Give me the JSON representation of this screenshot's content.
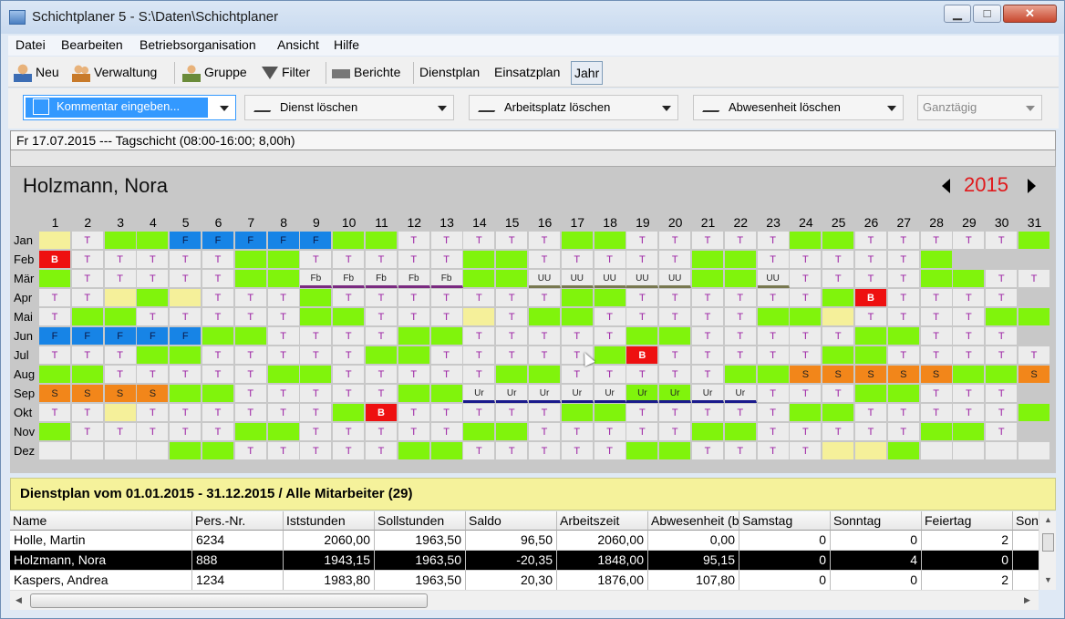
{
  "window": {
    "title": "Schichtplaner 5 - S:\\Daten\\Schichtplaner"
  },
  "menu": [
    "Datei",
    "Bearbeiten",
    "Betriebsorganisation",
    "Ansicht",
    "Hilfe"
  ],
  "toolbar": {
    "neu": "Neu",
    "verwaltung": "Verwaltung",
    "gruppe": "Gruppe",
    "filter": "Filter",
    "berichte": "Berichte",
    "dienstplan": "Dienstplan",
    "einsatzplan": "Einsatzplan",
    "jahr": "Jahr"
  },
  "dropdowns": {
    "kommentar": "Kommentar eingeben...",
    "dienst": "Dienst löschen",
    "arbeitsplatz": "Arbeitsplatz löschen",
    "abwesenheit": "Abwesenheit löschen",
    "ganztaegig": "Ganztägig"
  },
  "info": "Fr 17.07.2015 --- Tagschicht (08:00-16:00; 8,00h)",
  "calendar": {
    "employee": "Holzmann, Nora",
    "year": "2015",
    "days": [
      "1",
      "2",
      "3",
      "4",
      "5",
      "6",
      "7",
      "8",
      "9",
      "10",
      "11",
      "12",
      "13",
      "14",
      "15",
      "16",
      "17",
      "18",
      "19",
      "20",
      "21",
      "22",
      "23",
      "24",
      "25",
      "26",
      "27",
      "28",
      "29",
      "30",
      "31"
    ],
    "months": [
      {
        "label": "Jan",
        "cells": [
          "y",
          "T",
          "g",
          "g",
          "F:b",
          "F:b",
          "F:b",
          "F:b",
          "F:b",
          "g",
          "g",
          "T",
          "T",
          "T",
          "T",
          "T",
          "g",
          "g",
          "T",
          "T",
          "T",
          "T",
          "T",
          "g",
          "g",
          "T",
          "T",
          "T",
          "T",
          "T",
          "g"
        ]
      },
      {
        "label": "Feb",
        "cells": [
          "B:r",
          "T",
          "T",
          "T",
          "T",
          "T",
          "g",
          "g",
          "T",
          "T",
          "T",
          "T",
          "T",
          "g",
          "g",
          "T",
          "T",
          "T",
          "T",
          "T",
          "g",
          "g",
          "T",
          "T",
          "T",
          "T",
          "T",
          "g",
          "x",
          "x",
          "x"
        ]
      },
      {
        "label": "Mär",
        "cells": [
          "g",
          "T",
          "T",
          "T",
          "T",
          "T",
          "g",
          "g",
          "Fb:p",
          "Fb:p",
          "Fb:p",
          "Fb:p",
          "Fb:p",
          "g",
          "g",
          "UU:k",
          "UU:k",
          "UU:k",
          "UU:k",
          "UU:k",
          "g",
          "g",
          "UU:k",
          "T",
          "T",
          "T",
          "T",
          "g",
          "g",
          "T",
          "T"
        ]
      },
      {
        "label": "Apr",
        "cells": [
          "T",
          "T",
          "y",
          "g",
          "y",
          "T",
          "T",
          "T",
          "g",
          "T",
          "T",
          "T",
          "T",
          "T",
          "T",
          "T",
          "g",
          "g",
          "T",
          "T",
          "T",
          "T",
          "T",
          "T",
          "g",
          "B:r",
          "T",
          "T",
          "T",
          "T",
          "x"
        ]
      },
      {
        "label": "Mai",
        "cells": [
          "T",
          "g",
          "g",
          "T",
          "T",
          "T",
          "T",
          "T",
          "g",
          "g",
          "T",
          "T",
          "T",
          "y",
          "T",
          "g",
          "g",
          "T",
          "T",
          "T",
          "T",
          "T",
          "g",
          "g",
          "y",
          "T",
          "T",
          "T",
          "T",
          "g",
          "g"
        ]
      },
      {
        "label": "Jun",
        "cells": [
          "F:b",
          "F:b",
          "F:b",
          "F:b",
          "F:b",
          "g",
          "g",
          "T",
          "T",
          "T",
          "T",
          "g",
          "g",
          "T",
          "T",
          "T",
          "T",
          "T",
          "g",
          "g",
          "T",
          "T",
          "T",
          "T",
          "T",
          "g",
          "g",
          "T",
          "T",
          "T",
          "x"
        ]
      },
      {
        "label": "Jul",
        "cells": [
          "T",
          "T",
          "T",
          "g",
          "g",
          "T",
          "T",
          "T",
          "T",
          "T",
          "g",
          "g",
          "T",
          "T",
          "T",
          "T",
          "T",
          "g",
          "B:r",
          "T",
          "T",
          "T",
          "T",
          "T",
          "g",
          "g",
          "T",
          "T",
          "T",
          "T",
          "T"
        ]
      },
      {
        "label": "Aug",
        "cells": [
          "g",
          "g",
          "T",
          "T",
          "T",
          "T",
          "T",
          "g",
          "g",
          "T",
          "T",
          "T",
          "T",
          "T",
          "g",
          "g",
          "T",
          "T",
          "T",
          "T",
          "T",
          "g",
          "g",
          "S:o",
          "S:o",
          "S:o",
          "S:o",
          "S:o",
          "g",
          "g",
          "S:o"
        ]
      },
      {
        "label": "Sep",
        "cells": [
          "S:o",
          "S:o",
          "S:o",
          "S:o",
          "g",
          "g",
          "T",
          "T",
          "T",
          "T",
          "T",
          "g",
          "g",
          "Ur:n",
          "Ur:n",
          "Ur:n",
          "Ur:n",
          "Ur:n",
          "Ur:nG",
          "Ur:nG",
          "Ur:n",
          "Ur:n",
          "T",
          "T",
          "T",
          "g",
          "g",
          "T",
          "T",
          "T",
          "x"
        ]
      },
      {
        "label": "Okt",
        "cells": [
          "T",
          "T",
          "y",
          "T",
          "T",
          "T",
          "T",
          "T",
          "T",
          "g",
          "B:r",
          "T",
          "T",
          "T",
          "T",
          "T",
          "g",
          "g",
          "T",
          "T",
          "T",
          "T",
          "T",
          "g",
          "g",
          "T",
          "T",
          "T",
          "T",
          "T",
          "g"
        ]
      },
      {
        "label": "Nov",
        "cells": [
          "g",
          "T",
          "T",
          "T",
          "T",
          "T",
          "g",
          "g",
          "T",
          "T",
          "T",
          "T",
          "T",
          "g",
          "g",
          "T",
          "T",
          "T",
          "T",
          "T",
          "g",
          "g",
          "T",
          "T",
          "T",
          "T",
          "T",
          "g",
          "g",
          "T",
          "x"
        ]
      },
      {
        "label": "Dez",
        "cells": [
          "f",
          "f",
          "f",
          "f",
          "g",
          "g",
          "T",
          "T",
          "T",
          "T",
          "T",
          "g",
          "g",
          "T",
          "T",
          "T",
          "T",
          "T",
          "g",
          "g",
          "T",
          "T",
          "T",
          "T",
          "y",
          "y",
          "g",
          "f",
          "f",
          "f",
          "f"
        ]
      }
    ]
  },
  "summary": "Dienstplan vom 01.01.2015 - 31.12.2015 / Alle Mitarbeiter (29)",
  "table": {
    "columns": [
      "Name",
      "Pers.-Nr.",
      "Iststunden",
      "Sollstunden",
      "Saldo",
      "Arbeitszeit",
      "Abwesenheit (b",
      "Samstag",
      "Sonntag",
      "Feiertag",
      "Son"
    ],
    "rows": [
      [
        "Holle, Martin",
        "6234",
        "2060,00",
        "1963,50",
        "96,50",
        "2060,00",
        "0,00",
        "0",
        "0",
        "2",
        ""
      ],
      [
        "Holzmann, Nora",
        "888",
        "1943,15",
        "1963,50",
        "-20,35",
        "1848,00",
        "95,15",
        "0",
        "4",
        "0",
        ""
      ],
      [
        "Kaspers, Andrea",
        "1234",
        "1983,80",
        "1963,50",
        "20,30",
        "1876,00",
        "107,80",
        "0",
        "0",
        "2",
        ""
      ]
    ]
  }
}
